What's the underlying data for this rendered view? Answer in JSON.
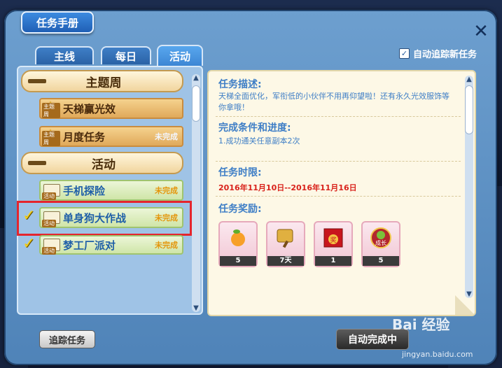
{
  "window": {
    "title": "任务手册"
  },
  "tabs": [
    {
      "label": "主线",
      "active": false
    },
    {
      "label": "每日",
      "active": false
    },
    {
      "label": "活动",
      "active": true
    }
  ],
  "auto_track": {
    "label": "自动追踪新任务",
    "checked": true
  },
  "left": {
    "sections": [
      {
        "label": "主题周"
      },
      {
        "label": "活动"
      }
    ],
    "items": [
      {
        "name": "天梯赢光效",
        "status": "",
        "icon": "star-icon",
        "tag": "主题周"
      },
      {
        "name": "月度任务",
        "status": "未完成",
        "icon": "star-icon",
        "tag": "主题周"
      },
      {
        "name": "手机探险",
        "status": "未完成",
        "icon": "scroll-icon",
        "tag": "活动"
      },
      {
        "name": "单身狗大作战",
        "status": "未完成",
        "icon": "scroll-icon",
        "tag": "活动"
      },
      {
        "name": "梦工厂派对",
        "status": "未完成",
        "icon": "scroll-icon",
        "tag": "活动"
      }
    ]
  },
  "detail": {
    "desc_title": "任务描述:",
    "desc_text": "天梯全面优化，军衔低的小伙伴不用再仰望啦！还有永久光效服饰等你拿哦！",
    "cond_title": "完成条件和进度:",
    "cond_text": "1.成功通关任意副本2次",
    "time_title": "任务时限:",
    "time_text": "2016年11月10日--2016年11月16日",
    "reward_title": "任务奖励:",
    "rewards": [
      {
        "qty": "5",
        "icon": "orange-fruit-icon"
      },
      {
        "qty": "7天",
        "icon": "golden-fan-icon"
      },
      {
        "qty": "1",
        "icon": "red-envelope-icon"
      },
      {
        "qty": "5",
        "icon": "growth-apple-icon"
      }
    ],
    "reward_red_text": "奖",
    "reward_grow_text": "成长"
  },
  "buttons": {
    "track": "追踪任务",
    "auto_complete": "自动完成中"
  },
  "watermark": {
    "brand": "Bai 经验",
    "url": "jingyan.baidu.com"
  }
}
